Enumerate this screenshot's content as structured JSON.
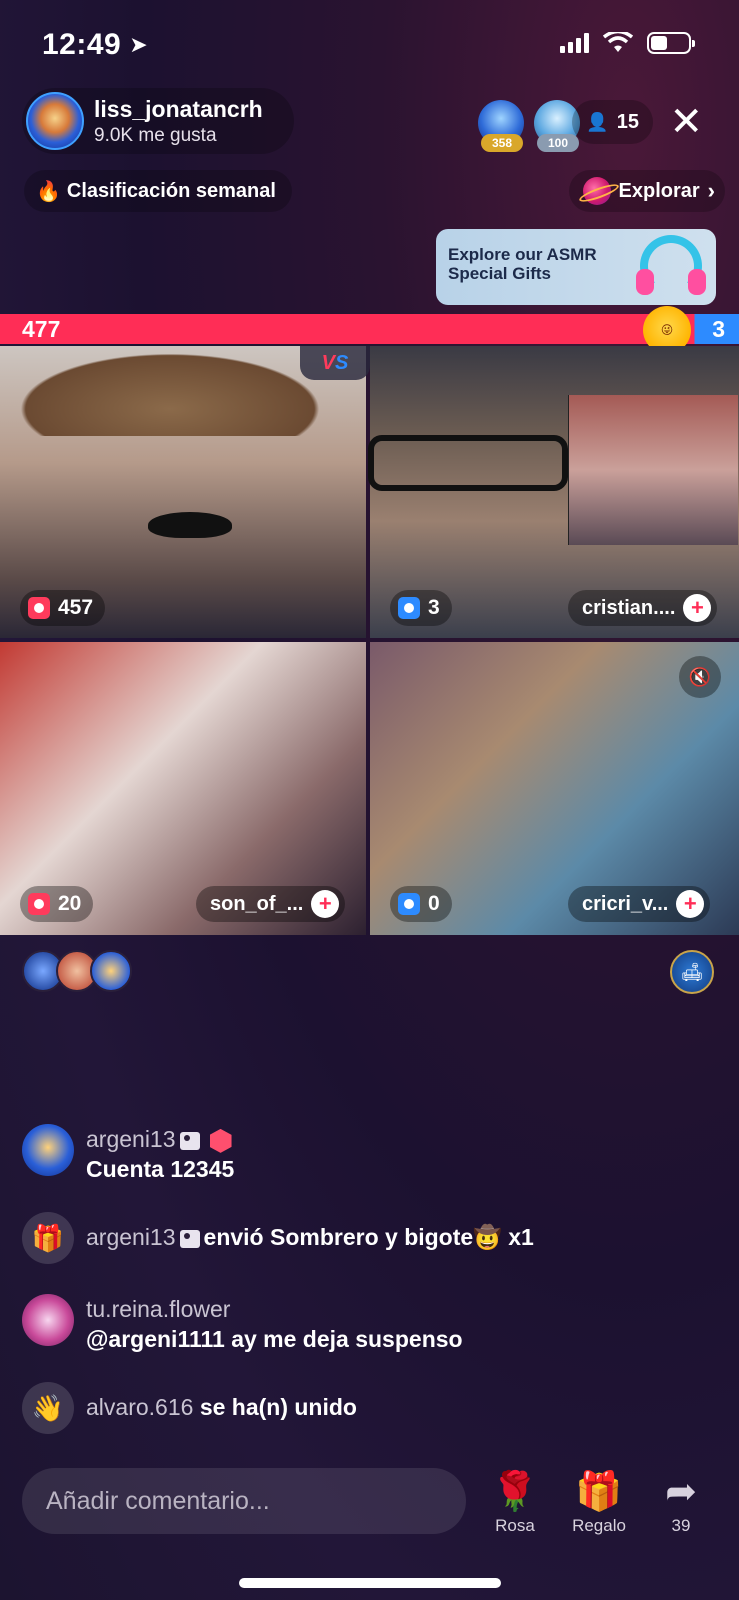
{
  "status_bar": {
    "time": "12:49"
  },
  "host": {
    "name": "liss_jonatancrh",
    "likes": "9.0K me gusta"
  },
  "top_viewers": [
    {
      "badge": "358"
    },
    {
      "badge": "100"
    }
  ],
  "viewer_count": "15",
  "weekly_rank_label": "Clasificación semanal",
  "explore_label": "Explorar",
  "banner": {
    "line1": "Explore our ASMR",
    "line2": "Special Gifts"
  },
  "battle": {
    "left_score": "477",
    "right_score": "3"
  },
  "tiles": [
    {
      "gifts": "457",
      "name": "",
      "gift_color": "#ff3b5c"
    },
    {
      "gifts": "3",
      "name": "cristian....",
      "gift_color": "#2d8bff"
    },
    {
      "gifts": "20",
      "name": "son_of_...",
      "gift_color": "#ff3b5c"
    },
    {
      "gifts": "0",
      "name": "cricri_v...",
      "gift_color": "#2d8bff"
    }
  ],
  "chat": [
    {
      "user": "argeni13",
      "message": "Cuenta 12345"
    },
    {
      "user": "argeni13",
      "message": "envió Sombrero y bigote",
      "suffix": "x1"
    },
    {
      "user": "tu.reina.flower",
      "message": "@argeni1111 ay me deja suspenso"
    },
    {
      "user": "alvaro.616",
      "message": "se ha(n) unido"
    }
  ],
  "comment_placeholder": "Añadir comentario...",
  "actions": {
    "rose": "Rosa",
    "gift": "Regalo",
    "share_count": "39"
  },
  "colors": {
    "red_team": "#ff2d56",
    "blue_team": "#2d8bff"
  }
}
